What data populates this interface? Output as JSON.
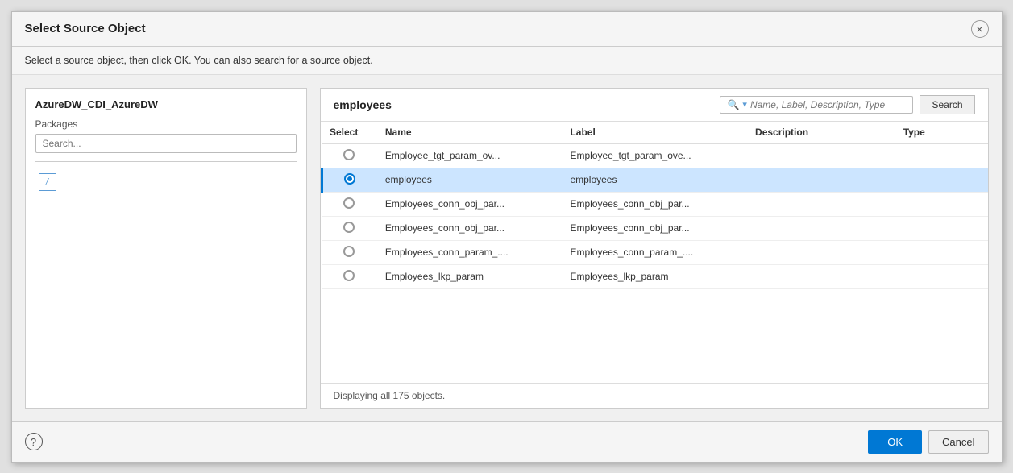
{
  "dialog": {
    "title": "Select Source Object",
    "subtitle": "Select a source object, then click OK. You can also search for a source object.",
    "close_label": "×"
  },
  "left_panel": {
    "connection_name": "AzureDW_CDI_AzureDW",
    "packages_label": "Packages",
    "search_placeholder": "Search...",
    "package_item_icon": "/",
    "package_item_name": ""
  },
  "right_panel": {
    "title": "employees",
    "search_placeholder": "Name, Label, Description, Type",
    "search_btn_label": "Search",
    "columns": [
      {
        "key": "select",
        "label": "Select"
      },
      {
        "key": "name",
        "label": "Name"
      },
      {
        "key": "label",
        "label": "Label"
      },
      {
        "key": "description",
        "label": "Description"
      },
      {
        "key": "type",
        "label": "Type"
      }
    ],
    "rows": [
      {
        "id": 1,
        "selected": false,
        "name": "Employee_tgt_param_ov...",
        "label": "Employee_tgt_param_ove...",
        "description": "",
        "type": ""
      },
      {
        "id": 2,
        "selected": true,
        "name": "employees",
        "label": "employees",
        "description": "",
        "type": ""
      },
      {
        "id": 3,
        "selected": false,
        "name": "Employees_conn_obj_par...",
        "label": "Employees_conn_obj_par...",
        "description": "",
        "type": ""
      },
      {
        "id": 4,
        "selected": false,
        "name": "Employees_conn_obj_par...",
        "label": "Employees_conn_obj_par...",
        "description": "",
        "type": ""
      },
      {
        "id": 5,
        "selected": false,
        "name": "Employees_conn_param_....",
        "label": "Employees_conn_param_....",
        "description": "",
        "type": ""
      },
      {
        "id": 6,
        "selected": false,
        "name": "Employees_lkp_param",
        "label": "Employees_lkp_param",
        "description": "",
        "type": ""
      }
    ],
    "status": "Displaying all 175 objects."
  },
  "footer": {
    "help_icon": "?",
    "ok_label": "OK",
    "cancel_label": "Cancel"
  }
}
